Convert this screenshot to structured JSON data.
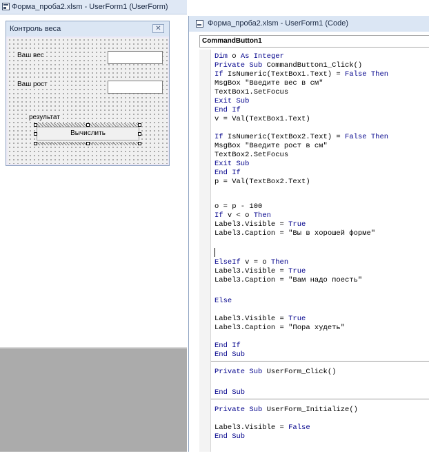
{
  "designer": {
    "title": "Форма_проба2.xlsm - UserForm1 (UserForm)"
  },
  "userform": {
    "title": "Контроль веса",
    "close_glyph": "✕",
    "label_weight": "Ваш вес",
    "label_height": "Ваш рост",
    "label_result": "результат",
    "button_label": "Вычислить",
    "textbox1_value": "",
    "textbox2_value": ""
  },
  "codewin": {
    "title": "Форма_проба2.xlsm - UserForm1 (Code)",
    "object_combo": "CommandButton1"
  },
  "code_lines": [
    "Dim o As Integer",
    "Private Sub CommandButton1_Click()",
    "If IsNumeric(TextBox1.Text) = False Then",
    "MsgBox \"Введите вес в см\"",
    "TextBox1.SetFocus",
    "Exit Sub",
    "End If",
    "v = Val(TextBox1.Text)",
    "If IsNumeric(TextBox2.Text) = False Then",
    "MsgBox \"Введите рост в см\"",
    "TextBox2.SetFocus",
    "Exit Sub",
    "End If",
    "p = Val(TextBox2.Text)",
    "o = p - 100",
    "If v < o Then",
    "Label3.Visible = True",
    "Label3.Caption = \"Вы в хорошей форме\"",
    "ElseIf v = o Then",
    "Label3.Visible = True",
    "Label3.Caption = \"Вам надо поесть\"",
    "Else",
    "Label3.Visible = True",
    "Label3.Caption = \"Пора худеть\"",
    "End If",
    "End Sub",
    "Private Sub UserForm_Click()",
    "End Sub",
    "Private Sub UserForm_Initialize()",
    "Label3.Visible = False",
    "End Sub"
  ],
  "colors": {
    "keyword": "#00008b",
    "title_bar": "#dbe6f4",
    "form_bg": "#f0f0f0"
  },
  "icons": [
    "userform-window-icon",
    "code-window-icon",
    "close-icon"
  ]
}
